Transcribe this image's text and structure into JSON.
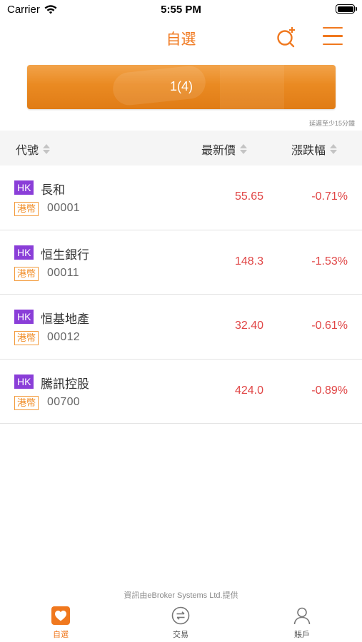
{
  "status_bar": {
    "carrier": "Carrier",
    "time": "5:55 PM"
  },
  "nav": {
    "title": "自選"
  },
  "banner": {
    "label": "1(4)"
  },
  "delay_note": "延遲至少15分鐘",
  "table": {
    "headers": {
      "code": "代號",
      "price": "最新價",
      "change": "漲跌幅"
    },
    "rows": [
      {
        "market": "HK",
        "name": "長和",
        "currency": "港幣",
        "code": "00001",
        "price": "55.65",
        "change": "-0.71%"
      },
      {
        "market": "HK",
        "name": "恒生銀行",
        "currency": "港幣",
        "code": "00011",
        "price": "148.3",
        "change": "-1.53%"
      },
      {
        "market": "HK",
        "name": "恒基地產",
        "currency": "港幣",
        "code": "00012",
        "price": "32.40",
        "change": "-0.61%"
      },
      {
        "market": "HK",
        "name": "騰訊控股",
        "currency": "港幣",
        "code": "00700",
        "price": "424.0",
        "change": "-0.89%"
      }
    ]
  },
  "footer": {
    "source": "資訊由eBroker Systems Ltd.提供"
  },
  "tabs": {
    "watchlist": "自選",
    "trade": "交易",
    "account": "賬戶"
  },
  "colors": {
    "accent": "#f0781e",
    "negative": "#e04545",
    "market_badge": "#8a3ed8"
  },
  "icons": {
    "search": "search-add-icon",
    "menu": "hamburger-menu-icon",
    "watchlist": "heart-icon",
    "trade": "exchange-icon",
    "account": "person-icon"
  }
}
